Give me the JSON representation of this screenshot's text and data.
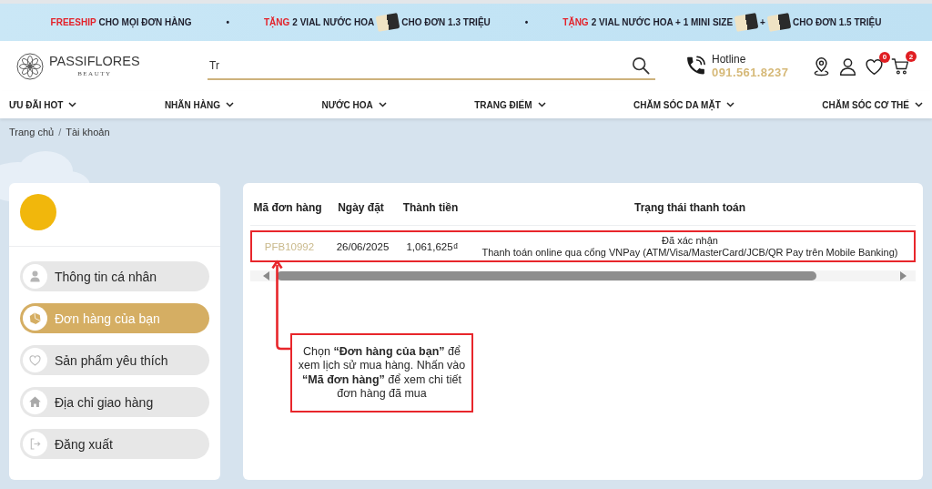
{
  "promo_bar": {
    "items": [
      {
        "kind": "promo",
        "parts": [
          {
            "kind": "highlight",
            "text": "FREESHIP"
          },
          {
            "kind": "text",
            "text": "CHO MỌI ĐƠN HÀNG"
          }
        ]
      },
      {
        "kind": "separator",
        "text": "•"
      },
      {
        "kind": "promo",
        "parts": [
          {
            "kind": "highlight",
            "text": "TẶNG"
          },
          {
            "kind": "text",
            "text": "2 VIAL NƯỚC HOA"
          },
          {
            "kind": "photo"
          },
          {
            "kind": "text",
            "text": "CHO ĐƠN 1.3 TRIỆU"
          }
        ]
      },
      {
        "kind": "separator",
        "text": "•"
      },
      {
        "kind": "promo",
        "parts": [
          {
            "kind": "highlight",
            "text": "TẶNG"
          },
          {
            "kind": "text",
            "text": "2 VIAL NƯỚC HOA + 1 MINI SIZE"
          },
          {
            "kind": "photo"
          },
          {
            "kind": "text",
            "text": "+"
          },
          {
            "kind": "photo"
          },
          {
            "kind": "text",
            "text": "CHO ĐƠN 1.5 TRIỆU"
          }
        ]
      }
    ]
  },
  "header": {
    "logo": {
      "name": "PASSIFLORES",
      "tagline": "BEAUTY"
    },
    "search": {
      "value": "Tr"
    },
    "hotline": {
      "label": "Hotline",
      "number": "091.561.8237"
    },
    "actions": [
      {
        "kind": "location"
      },
      {
        "kind": "account"
      },
      {
        "kind": "wishlist",
        "badge": "0"
      },
      {
        "kind": "cart",
        "badge": "2"
      }
    ]
  },
  "nav": {
    "items": [
      {
        "label": "ƯU ĐÃI HOT"
      },
      {
        "label": "NHÃN HÀNG"
      },
      {
        "label": "NƯỚC HOA"
      },
      {
        "label": "TRANG ĐIỂM"
      },
      {
        "label": "CHĂM SÓC DA MẶT"
      },
      {
        "label": "CHĂM SÓC CƠ THỂ"
      }
    ]
  },
  "breadcrumb": [
    {
      "kind": "link",
      "text": "Trang chủ"
    },
    {
      "kind": "separator",
      "text": "/"
    },
    {
      "kind": "current",
      "text": "Tài khoản"
    }
  ],
  "sidebar": {
    "menu": [
      {
        "kind": "profile",
        "label": "Thông tin cá nhân",
        "selected": false
      },
      {
        "kind": "orders",
        "label": "Đơn hàng của bạn",
        "selected": true
      },
      {
        "kind": "wishlist",
        "label": "Sản phẩm yêu thích",
        "selected": false
      },
      {
        "kind": "address",
        "label": "Địa chỉ giao hàng",
        "selected": false
      },
      {
        "kind": "logout",
        "label": "Đăng xuất",
        "selected": false
      }
    ]
  },
  "orders_table": {
    "columns": [
      "Mã đơn hàng",
      "Ngày đặt",
      "Thành tiền",
      "Trạng thái thanh toán"
    ],
    "rows": [
      {
        "order_code": "PFB10992",
        "date": "26/06/2025",
        "total": "1,061,625₫",
        "status": "Đã xác nhận",
        "payment": "Thanh toán online qua cổng VNPay (ATM/Visa/MasterCard/JCB/QR Pay trên Mobile Banking)",
        "highlighted": true
      }
    ]
  },
  "annotation": {
    "text": "Chọn **“Đơn hàng của bạn”** để xem lịch sử mua hàng. Nhấn vào **“Mã đơn hàng”** để xem chi tiết đơn hàng đã mua"
  }
}
